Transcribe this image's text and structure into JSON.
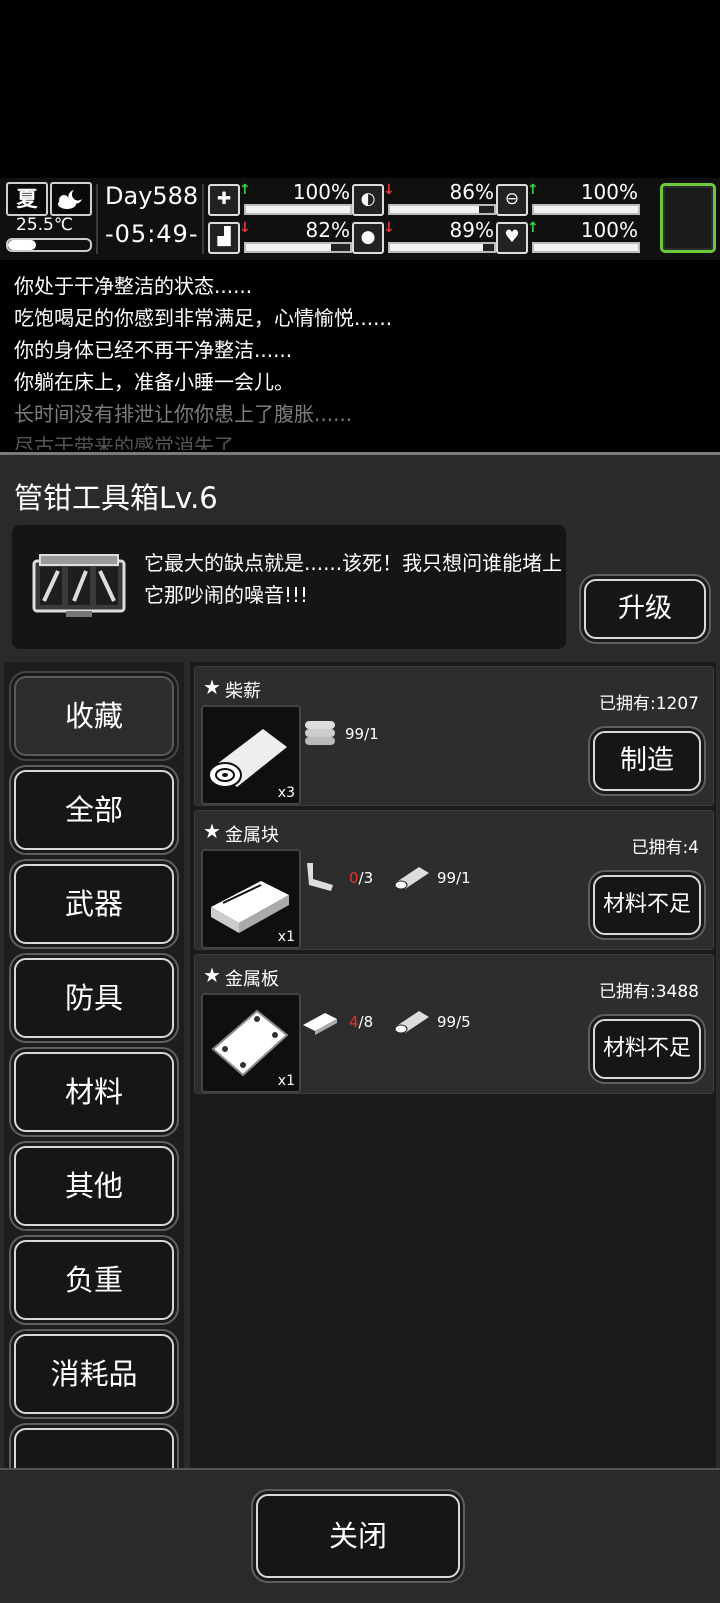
{
  "hud": {
    "season": "夏",
    "weather_icon": "cloud-moon-icon",
    "temperature": "25.5℃",
    "day": "Day588",
    "time": "-05:49-",
    "stats": [
      {
        "name": "health",
        "icon": "medkit-icon",
        "trend": "up",
        "value": "100%",
        "level": 1.0
      },
      {
        "name": "hunger",
        "icon": "stomach-icon",
        "trend": "down",
        "value": "86%",
        "level": 0.86
      },
      {
        "name": "mood",
        "icon": "capsule-icon",
        "trend": "up",
        "value": "100%",
        "level": 1.0
      },
      {
        "name": "stamina",
        "icon": "boot-icon",
        "trend": "down",
        "value": "82%",
        "level": 0.82
      },
      {
        "name": "thirst",
        "icon": "water-drop-icon",
        "trend": "down",
        "value": "89%",
        "level": 0.89
      },
      {
        "name": "heart",
        "icon": "heart-icon",
        "trend": "up",
        "value": "100%",
        "level": 1.0
      }
    ]
  },
  "log": {
    "lines": [
      "你处于干净整洁的状态......",
      "吃饱喝足的你感到非常满足，心情愉悦......",
      "你的身体已经不再干净整洁......",
      "你躺在床上，准备小睡一会儿。",
      "长时间没有排泄让你你患上了腹胀......",
      "尽古干带来的感觉消失了"
    ]
  },
  "panel": {
    "title": "管钳工具箱Lv.6",
    "description": "它最大的缺点就是......该死！我只想问谁能堵上它那吵闹的噪音!!!",
    "upgrade_label": "升级"
  },
  "categories": [
    "收藏",
    "全部",
    "武器",
    "防具",
    "材料",
    "其他",
    "负重",
    "消耗品"
  ],
  "active_category": "收藏",
  "recipes": [
    {
      "name": "柴薪",
      "owned": "已拥有:1207",
      "qty": "x3",
      "icon": "firewood-icon",
      "materials": [
        {
          "icon": "firewood-icon",
          "have": "99",
          "need": "/1",
          "short": false
        }
      ],
      "action": "制造"
    },
    {
      "name": "金属块",
      "owned": "已拥有:4",
      "qty": "x1",
      "icon": "metal-block-icon",
      "materials": [
        {
          "icon": "pipe-wrench-icon",
          "have": "0",
          "need": "/3",
          "short": true
        },
        {
          "icon": "firewood-icon",
          "have": "99",
          "need": "/1",
          "short": false
        }
      ],
      "action": "材料不足"
    },
    {
      "name": "金属板",
      "owned": "已拥有:3488",
      "qty": "x1",
      "icon": "metal-plate-icon",
      "materials": [
        {
          "icon": "metal-block-icon",
          "have": "4",
          "need": "/8",
          "short": true
        },
        {
          "icon": "firewood-icon",
          "have": "99",
          "need": "/5",
          "short": false
        }
      ],
      "action": "材料不足"
    }
  ],
  "footer": {
    "close_label": "关闭"
  }
}
